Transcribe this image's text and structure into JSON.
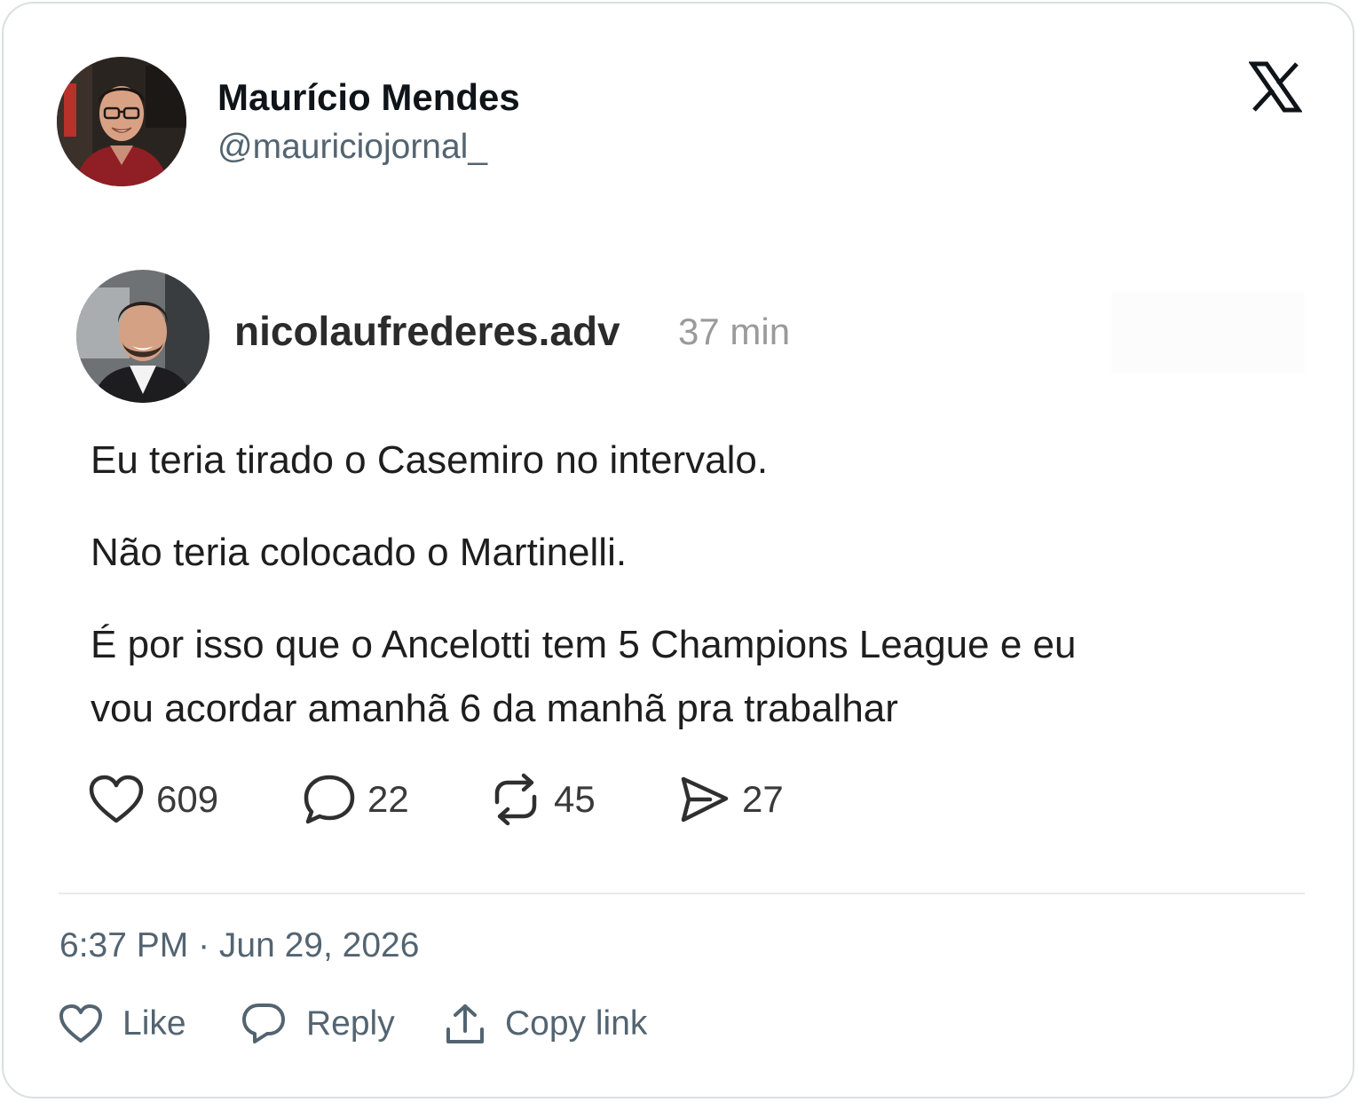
{
  "post": {
    "author_name": "Maurício Mendes",
    "author_handle": "@mauriciojornal_",
    "timestamp": "6:37 PM · Jun 29, 2026",
    "platform_icon": "x-logo-icon"
  },
  "embedded": {
    "username": "nicolaufrederes.adv",
    "time": "37 min",
    "lines": [
      "Eu teria tirado o Casemiro no intervalo.",
      "Não teria colocado o Martinelli.",
      "É por isso que o Ancelotti tem 5 Champions League e eu",
      "vou acordar amanhã 6 da manhã pra trabalhar"
    ],
    "stats": {
      "likes": "609",
      "comments": "22",
      "reposts": "45",
      "shares": "27"
    }
  },
  "actions": {
    "like": "Like",
    "reply": "Reply",
    "copy_link": "Copy link"
  },
  "colors": {
    "primary_text": "#0f1419",
    "secondary_text": "#536471",
    "border": "#d9dfe3"
  }
}
